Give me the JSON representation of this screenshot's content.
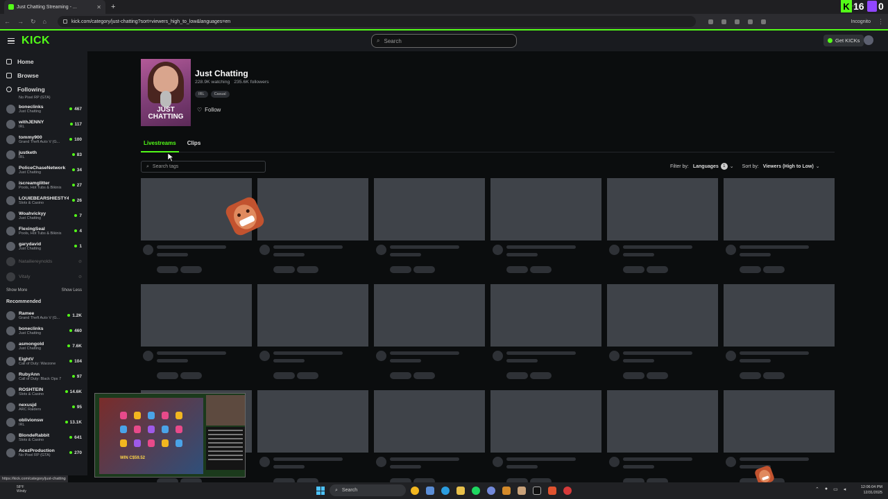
{
  "browser": {
    "tab_title": "Just Chatting Streaming - ...",
    "url": "kick.com/category/just-chatting?sort=viewers_high_to_low&languages=en",
    "incognito_label": "Incognito",
    "corner_badge_num": "16",
    "corner_badge_zero": "0",
    "status_url": "https://kick.com/category/just-chatting"
  },
  "header": {
    "logo": "KICK",
    "search_placeholder": "Search",
    "get_kicks": "Get KICKs"
  },
  "sidebar": {
    "nav": [
      {
        "label": "Home",
        "icon": "home-icon"
      },
      {
        "label": "Browse",
        "icon": "browse-icon"
      },
      {
        "label": "Following",
        "icon": "heart-icon"
      }
    ],
    "top_stub": "No Pixel RP (GTA)",
    "following": [
      {
        "name": "boneclinks",
        "game": "Just Chatting",
        "viewers": "467",
        "live": true
      },
      {
        "name": "withJENNY",
        "game": "IRL",
        "viewers": "117",
        "live": true
      },
      {
        "name": "tommy900",
        "game": "Grand Theft Auto V (G...",
        "viewers": "100",
        "live": true
      },
      {
        "name": "justketh",
        "game": "IRL",
        "viewers": "83",
        "live": true
      },
      {
        "name": "PoliceChaseNetwork",
        "game": "Just Chatting",
        "viewers": "34",
        "live": true
      },
      {
        "name": "iscreamglitter",
        "game": "Pools, Hot Tubs & Bikinis",
        "viewers": "27",
        "live": true
      },
      {
        "name": "LOUIEBEARSHIESTY4",
        "game": "Slots & Casino",
        "viewers": "26",
        "live": true
      },
      {
        "name": "Woahvickyy",
        "game": "Just Chatting",
        "viewers": "7",
        "live": true
      },
      {
        "name": "FlexingSeal",
        "game": "Pools, Hot Tubs & Bikinis",
        "viewers": "4",
        "live": true
      },
      {
        "name": "garydavid",
        "game": "Just Chatting",
        "viewers": "1",
        "live": true
      },
      {
        "name": "Natailiereynolds",
        "game": "",
        "viewers": "",
        "live": false
      },
      {
        "name": "Vitaly",
        "game": "",
        "viewers": "",
        "live": false
      }
    ],
    "show_more": "Show More",
    "show_less": "Show Less",
    "recommended_header": "Recommended",
    "recommended": [
      {
        "name": "Ramee",
        "game": "Grand Theft Auto V (G...",
        "viewers": "1.2K"
      },
      {
        "name": "boneclinks",
        "game": "Just Chatting",
        "viewers": "460"
      },
      {
        "name": "asmongold",
        "game": "Just Chatting",
        "viewers": "7.6K"
      },
      {
        "name": "EightV",
        "game": "Call of Duty: Warzone",
        "viewers": "104"
      },
      {
        "name": "RubyAnn",
        "game": "Call of Duty: Black Ops 7",
        "viewers": "97"
      },
      {
        "name": "ROSHTEIN",
        "game": "Slots & Casino",
        "viewers": "14.6K"
      },
      {
        "name": "nexusjd",
        "game": "ARC Raiders",
        "viewers": "95"
      },
      {
        "name": "oblivionsw",
        "game": "IRL",
        "viewers": "13.1K"
      },
      {
        "name": "BlondeRabbit",
        "game": "Slots & Casino",
        "viewers": "641"
      },
      {
        "name": "AcezProduction",
        "game": "No Pixel RP (GTA)",
        "viewers": "270"
      }
    ]
  },
  "category": {
    "title": "Just Chatting",
    "image_text": "JUST CHATTING",
    "watching": "228.9K watching",
    "followers": "235.6K followers",
    "tags": [
      "IRL",
      "Casual"
    ],
    "follow_label": "Follow",
    "tabs": [
      "Livestreams",
      "Clips"
    ],
    "tag_search_placeholder": "Search tags",
    "filter_by": "Filter by:",
    "languages": "Languages",
    "languages_count": "1",
    "sort_by": "Sort by:",
    "sort_value": "Viewers (High to Low)"
  },
  "overlay": {
    "slot_win": "WIN C$59.52"
  },
  "taskbar": {
    "weather_temp": "58°F",
    "weather_desc": "Windy",
    "search_label": "Search",
    "time": "12:06:04 PM",
    "date": "12/31/2025"
  }
}
